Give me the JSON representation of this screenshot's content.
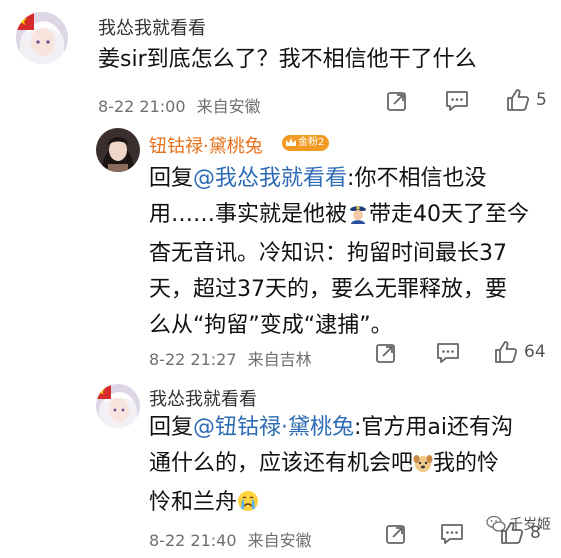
{
  "comments": [
    {
      "username": "我怂我就看看",
      "text_lines": [
        "姜sir到底怎么了？我不相信他干了什么"
      ],
      "time": "8-22 21:00",
      "location": "来自安徽",
      "likes": "5",
      "avatar_icon": "anime-girl-avatar-icon"
    },
    {
      "username": "钮钴禄·黛桃兔",
      "badge": "金粉2",
      "reply_prefix": "回复",
      "mention": "@我怂我就看看",
      "line1_rest": ":你不相信也没",
      "line2_a": "用……事实就是他被",
      "line2_b": "带走40天了至今",
      "line3": "杳无音讯。冷知识：拘留时间最长37",
      "line4": "天，超过37天的，要么无罪释放，要",
      "line5": "么从“拘留”变成“逮捕”。",
      "time": "8-22 21:27",
      "location": "来自吉林",
      "likes": "64",
      "avatar_icon": "girl-photo-avatar-icon"
    },
    {
      "username": "我怂我就看看",
      "reply_prefix": "回复",
      "mention": "@钮钴禄·黛桃兔",
      "line1_rest": ":官方用ai还有沟",
      "line2_a": "通什么的，应该还有机会吧",
      "line2_b": "我的怜",
      "line3": "怜和兰舟",
      "time": "8-22 21:40",
      "location": "来自安徽",
      "likes": "8"
    }
  ],
  "watermark": "千岁姬",
  "icons": {
    "forward": "share-forward-icon",
    "comment": "comment-bubble-icon",
    "like": "thumbs-up-icon",
    "police": "police-officer-emoji",
    "dog": "dog-face-emoji",
    "crying": "crying-face-emoji"
  },
  "colors": {
    "mention": "#2d6bb5",
    "username_highlight": "#e8701a",
    "meta_gray": "#6f6f6f"
  }
}
